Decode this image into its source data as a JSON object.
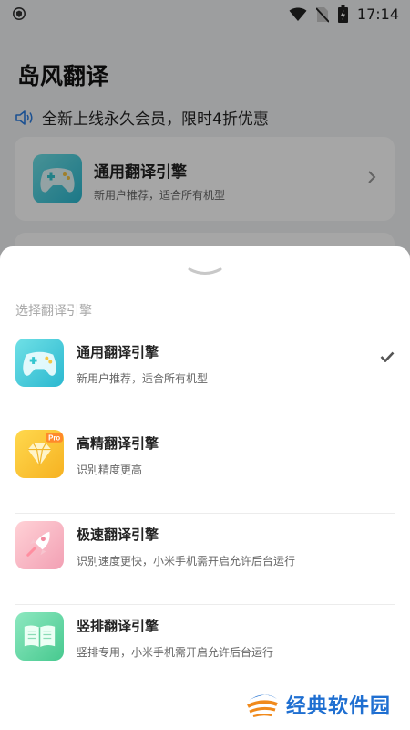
{
  "status": {
    "time": "17:14"
  },
  "app": {
    "title": "岛风翻译",
    "notice": "全新上线永久会员，限时4折优惠",
    "current_engine": {
      "title": "通用翻译引擎",
      "subtitle": "新用户推荐，适合所有机型"
    }
  },
  "sheet": {
    "title": "选择翻译引擎",
    "options": [
      {
        "title": "通用翻译引擎",
        "subtitle": "新用户推荐，适合所有机型",
        "icon": "gamepad-icon",
        "selected": true
      },
      {
        "title": "高精翻译引擎",
        "subtitle": "识别精度更高",
        "icon": "diamond-pro-icon",
        "badge": "Pro",
        "selected": false
      },
      {
        "title": "极速翻译引擎",
        "subtitle": "识别速度更快，小米手机需开启允许后台运行",
        "icon": "rocket-icon",
        "selected": false
      },
      {
        "title": "竖排翻译引擎",
        "subtitle": "竖排专用，小米手机需开启允许后台运行",
        "icon": "book-icon",
        "selected": false
      }
    ]
  },
  "watermark": {
    "text": "经典软件园"
  },
  "colors": {
    "accent_blue": "#1f6fd1",
    "teal": "#35c6cf",
    "yellow": "#f8c431",
    "pink": "#f6a7b0",
    "green": "#5ed6a1"
  }
}
